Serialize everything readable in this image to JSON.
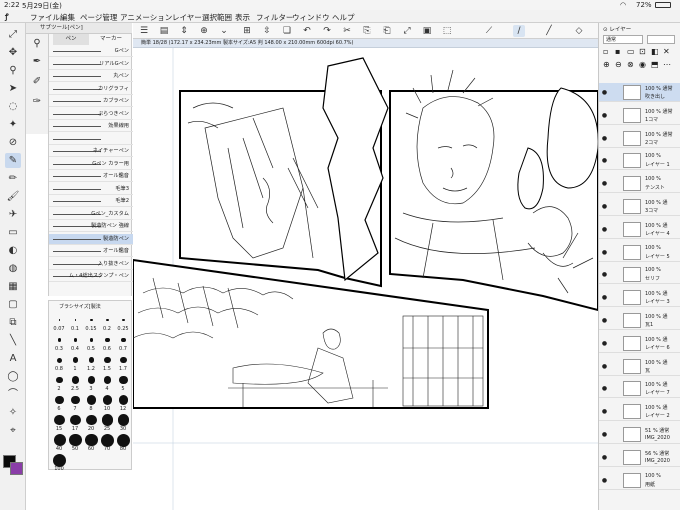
{
  "status": {
    "time": "2:22",
    "date": "5月29日(金)",
    "battery": "72%"
  },
  "menu": {
    "logo": "ꝭ",
    "items": [
      "ファイル",
      "編集",
      "ページ管理",
      "アニメーション",
      "レイヤー",
      "選択範囲",
      "表示",
      "フィルター",
      "ウィンドウ",
      "ヘルプ"
    ]
  },
  "file_tab": "簡単 18/28 (172.17 x 234.23mm 製本サイズ:A5 判 148.00 x 210.00mm 600dpi 60.7%)",
  "subtool": {
    "title": "サブツール[ペン]",
    "tab_pen": "ペン",
    "tab_marker": "マーカー",
    "brushes": [
      "Gペン",
      "リアルGペン",
      "丸ペン",
      "カリグラフィ",
      "カブラペン",
      "ぷらつきペン",
      "効果線用",
      "",
      "ネイチャーペン",
      "Gペン カラー用",
      "オール鑑音",
      "毛筆3",
      "毛筆2",
      "Gペン_カスタム",
      "製造防ペン 強線",
      "製造防ペン",
      "オール鑑音",
      "入り抜きペン",
      "ム・4総出スタンプ・ペン"
    ]
  },
  "brush_size": {
    "title": "ブラシサイズ[製法",
    "sizes": [
      "0.07",
      "0.1",
      "0.15",
      "0.2",
      "0.25",
      "0.3",
      "0.4",
      "0.5",
      "0.6",
      "0.7",
      "0.8",
      "1",
      "1.2",
      "1.5",
      "1.7",
      "2",
      "2.5",
      "3",
      "4",
      "5",
      "6",
      "7",
      "8",
      "10",
      "12",
      "15",
      "17",
      "20",
      "25",
      "30",
      "40",
      "50",
      "60",
      "70",
      "80",
      "100"
    ]
  },
  "layers": {
    "blend": "通常",
    "title": "レイヤー",
    "rows": [
      {
        "pct": "100 % 通常",
        "name": "吹き出し"
      },
      {
        "pct": "100 % 通常",
        "name": "1コマ"
      },
      {
        "pct": "100 % 通常",
        "name": "2コマ"
      },
      {
        "pct": "100 %",
        "name": "レイヤー 1"
      },
      {
        "pct": "100 %",
        "name": "テンスト"
      },
      {
        "pct": "100 % 通",
        "name": "3コマ"
      },
      {
        "pct": "100 % 通",
        "name": "レイヤー 4"
      },
      {
        "pct": "100 %",
        "name": "レイヤー 5"
      },
      {
        "pct": "100 %",
        "name": "セリフ"
      },
      {
        "pct": "100 % 通",
        "name": "レイヤー 3"
      },
      {
        "pct": "100 % 通",
        "name": "瓦1"
      },
      {
        "pct": "100 % 通",
        "name": "レイヤー 6"
      },
      {
        "pct": "100 % 通",
        "name": "瓦"
      },
      {
        "pct": "100 % 通",
        "name": "レイヤー 7"
      },
      {
        "pct": "100 % 通",
        "name": "レイヤー 2"
      },
      {
        "pct": "51 % 通常",
        "name": "IMG_2020"
      },
      {
        "pct": "56 % 通常",
        "name": "IMG_2020"
      },
      {
        "pct": "100 %",
        "name": "用紙"
      }
    ]
  },
  "colors": {
    "main": "#0b0b0b",
    "sub": "#8a3da8",
    "accent": "#c7d8ef"
  }
}
